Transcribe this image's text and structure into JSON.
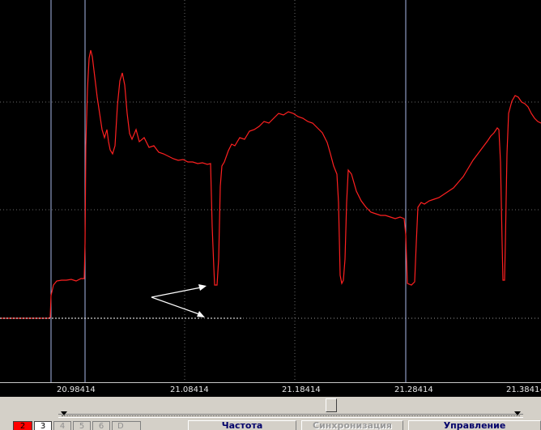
{
  "colors": {
    "background": "#000000",
    "trace": "#ff2020",
    "grid": "#6a6a6a",
    "cursor": "#a8b8e8",
    "marker": "#ffffff",
    "panel": "#d4d0c8",
    "active_channel": "#ff0000"
  },
  "time_axis": {
    "ticks": [
      "20.98414",
      "21.08414",
      "21.18414",
      "21.28414",
      "21.38414"
    ]
  },
  "scrollbar": {
    "position": 0.58
  },
  "channel_tabs": [
    {
      "label": "2",
      "state": "active"
    },
    {
      "label": "3",
      "state": "enabled"
    },
    {
      "label": "4",
      "state": "disabled"
    },
    {
      "label": "5",
      "state": "disabled"
    },
    {
      "label": "6",
      "state": "disabled"
    },
    {
      "label": "D",
      "state": "disabled"
    }
  ],
  "panel_tabs": [
    {
      "label": "Частота",
      "state": "enabled"
    },
    {
      "label": "Синхронизация",
      "state": "disabled"
    },
    {
      "label": "Управление",
      "state": "enabled"
    }
  ]
}
